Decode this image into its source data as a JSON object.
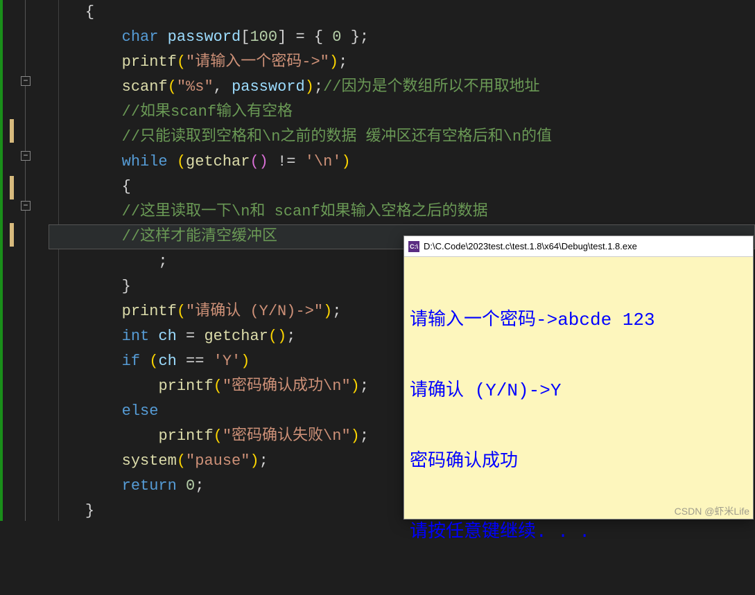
{
  "code": {
    "l0": "{",
    "l1_kw_char": "char",
    "l1_var": " password",
    "l1_rest1": "[",
    "l1_num1": "100",
    "l1_rest2": "] = { ",
    "l1_num2": "0",
    "l1_rest3": " };",
    "l2_fn": "printf",
    "l2_p1": "(",
    "l2_str": "\"请输入一个密码->\"",
    "l2_p2": ")",
    "l2_semi": ";",
    "l3_fn": "scanf",
    "l3_p1": "(",
    "l3_str": "\"%s\"",
    "l3_comma": ", ",
    "l3_var": "password",
    "l3_p2": ")",
    "l3_semi": ";",
    "l3_cmt": "//因为是个数组所以不用取地址",
    "l4_cmt": "//如果scanf输入有空格",
    "l5_cmt": "//只能读取到空格和\\n之前的数据 缓冲区还有空格后和\\n的值",
    "l6_kw": "while",
    "l6_sp": " ",
    "l6_p1": "(",
    "l6_fn": "getchar",
    "l6_pp": "()",
    "l6_op": " != ",
    "l6_str": "'\\n'",
    "l6_p2": ")",
    "l7": "{",
    "l8_cmt": "//这里读取一下\\n和 scanf如果输入空格之后的数据",
    "l9_cmt": "//这样才能清空缓冲区",
    "l10": "    ;",
    "l11": "}",
    "l12_fn": "printf",
    "l12_p1": "(",
    "l12_str": "\"请确认 (Y/N)->\"",
    "l12_p2": ")",
    "l12_semi": ";",
    "l13_kw": "int",
    "l13_var": " ch",
    "l13_eq": " = ",
    "l13_fn": "getchar",
    "l13_pp": "()",
    "l13_semi": ";",
    "l14_kw": "if",
    "l14_sp": " ",
    "l14_p1": "(",
    "l14_var": "ch",
    "l14_op": " == ",
    "l14_str": "'Y'",
    "l14_p2": ")",
    "l15_fn": "printf",
    "l15_p1": "(",
    "l15_str": "\"密码确认成功\\n\"",
    "l15_p2": ")",
    "l15_semi": ";",
    "l16_kw": "else",
    "l17_fn": "printf",
    "l17_p1": "(",
    "l17_str": "\"密码确认失败\\n\"",
    "l17_p2": ")",
    "l17_semi": ";",
    "l18_fn": "system",
    "l18_p1": "(",
    "l18_str": "\"pause\"",
    "l18_p2": ")",
    "l18_semi": ";",
    "l19_kw": "return",
    "l19_sp": " ",
    "l19_num": "0",
    "l19_semi": ";",
    "l20": "}"
  },
  "console": {
    "title": "D:\\C.Code\\2023test.c\\test.1.8\\x64\\Debug\\test.1.8.exe",
    "icon_text": "C:\\",
    "lines": {
      "l1": "请输入一个密码->abcde 123",
      "l2": "请确认 (Y/N)->Y",
      "l3": "密码确认成功",
      "l4": "请按任意键继续. . ."
    }
  },
  "fold_glyph": "−",
  "watermark": "CSDN @虾米Life"
}
